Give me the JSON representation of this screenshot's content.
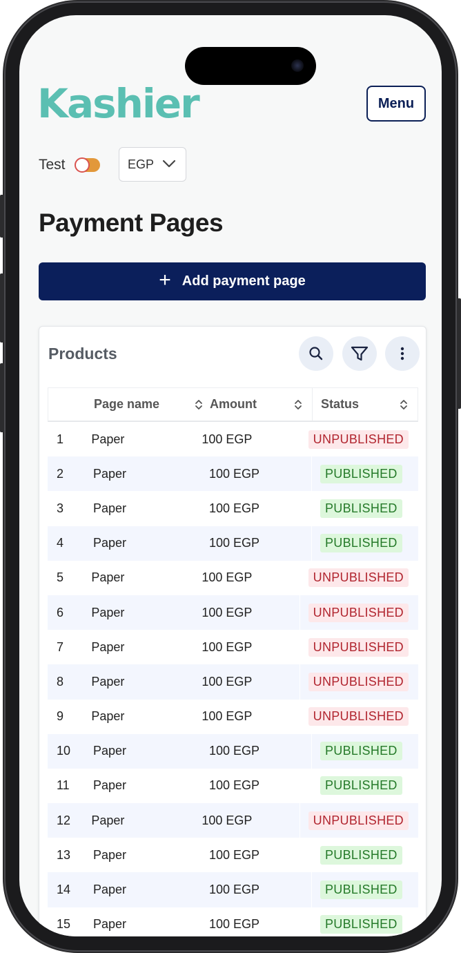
{
  "brand": {
    "logo_text": "Kashier",
    "logo_color": "#5bbfb2",
    "accent": "#0b1f5b"
  },
  "header": {
    "menu_label": "Menu"
  },
  "env": {
    "test_label": "Test",
    "toggle_on": true,
    "currency": "EGP"
  },
  "page": {
    "title": "Payment Pages",
    "add_label": "Add payment page"
  },
  "products": {
    "title": "Products",
    "actions": [
      "search-icon",
      "filter-icon",
      "more-vertical-icon"
    ],
    "columns": {
      "name": "Page name",
      "amount": "Amount",
      "status": "Status"
    },
    "rows": [
      {
        "num": "1",
        "name": "Paper",
        "amount": "100 EGP",
        "status": "UNPUBLISHED"
      },
      {
        "num": "2",
        "name": "Paper",
        "amount": "100 EGP",
        "status": "PUBLISHED"
      },
      {
        "num": "3",
        "name": "Paper",
        "amount": "100 EGP",
        "status": "PUBLISHED"
      },
      {
        "num": "4",
        "name": "Paper",
        "amount": "100 EGP",
        "status": "PUBLISHED"
      },
      {
        "num": "5",
        "name": "Paper",
        "amount": "100 EGP",
        "status": "UNPUBLISHED"
      },
      {
        "num": "6",
        "name": "Paper",
        "amount": "100 EGP",
        "status": "UNPUBLISHED"
      },
      {
        "num": "7",
        "name": "Paper",
        "amount": "100 EGP",
        "status": "UNPUBLISHED"
      },
      {
        "num": "8",
        "name": "Paper",
        "amount": "100 EGP",
        "status": "UNPUBLISHED"
      },
      {
        "num": "9",
        "name": "Paper",
        "amount": "100 EGP",
        "status": "UNPUBLISHED"
      },
      {
        "num": "10",
        "name": "Paper",
        "amount": "100 EGP",
        "status": "PUBLISHED"
      },
      {
        "num": "11",
        "name": "Paper",
        "amount": "100 EGP",
        "status": "PUBLISHED"
      },
      {
        "num": "12",
        "name": "Paper",
        "amount": "100 EGP",
        "status": "UNPUBLISHED"
      },
      {
        "num": "13",
        "name": "Paper",
        "amount": "100 EGP",
        "status": "PUBLISHED"
      },
      {
        "num": "14",
        "name": "Paper",
        "amount": "100 EGP",
        "status": "PUBLISHED"
      },
      {
        "num": "15",
        "name": "Paper",
        "amount": "100 EGP",
        "status": "PUBLISHED"
      }
    ]
  }
}
